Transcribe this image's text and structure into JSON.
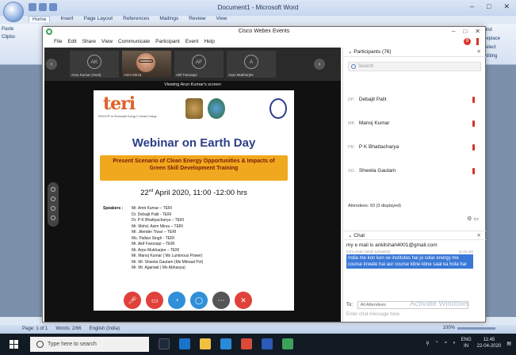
{
  "word": {
    "title": "Document1 - Microsoft Word",
    "tabs": [
      "Home",
      "Insert",
      "Page Layout",
      "References",
      "Mailings",
      "Review",
      "View"
    ],
    "ribbon_left": [
      "Paste",
      "Clipbo"
    ],
    "ribbon_right": [
      "Find",
      "Replace",
      "Select",
      "Editing"
    ],
    "status": {
      "page": "Page: 1 of 1",
      "words": "Words: 2/66",
      "lang": "English (India)",
      "zoom": "100%"
    }
  },
  "webex": {
    "title": "Cisco Webex Events",
    "menu": [
      "File",
      "Edit",
      "Share",
      "View",
      "Communicate",
      "Participant",
      "Event",
      "Help"
    ],
    "help_badge": "8",
    "thumbs": [
      {
        "initials": "AK",
        "name": "Arun Kumar (Host)"
      },
      {
        "initials": "",
        "name": "Asim Mirza"
      },
      {
        "initials": "AF",
        "name": "Akif Farooqui"
      },
      {
        "initials": "A",
        "name": "Arpo Mukherjee"
      }
    ],
    "viewing": "Viewing Arun Kumar's screen",
    "slide": {
      "logo": "teri",
      "logo_sub": "ENVIS RP on Renewable Energy & Climate Change",
      "title": "Webinar on Earth Day",
      "band_line1": "Present Scenario of Clean Energy Opportunities & Impacts of",
      "band_line2": "Green Skill Development Training",
      "date_day": "22",
      "date_sup": "nd",
      "date_rest": " April 2020, 11:00 -12:00 hrs",
      "speakers_label": "Speakers :",
      "speakers": [
        "Mr. Amit Kumar – TERI",
        "Dr. Debajit Palit - TERI",
        "Dr. P K Bhattyacharya – TERI",
        "Mr. Mohd. Asim Mirza – TERI",
        "Mr. Jitender Tiwar – TERI",
        "Ms. Pallavi Singh  - TERI",
        "Mr. Akif Farooqui – TERI",
        "Mr. Arpo Mukharjee – TERI",
        "Mr. Manoj Kumar ( Ms Luminous Power)",
        "Mr. Mr. Shweta Gautam (Ms Mimaat Pvt)",
        "Mr. Mr. Agarwal ( Ms Abhasya)"
      ]
    },
    "participants": {
      "header": "Participants (76)",
      "search_placeholder": "Search",
      "rows": [
        {
          "ini": "DP",
          "name": "Debajit Palit"
        },
        {
          "ini": "MK",
          "name": "Manoj Kumar"
        },
        {
          "ini": "PB",
          "name": "P K Bhattacharya"
        },
        {
          "ini": "SG",
          "name": "Shweta Gautam"
        }
      ],
      "attendees": "Attendees: 93 (3 displayed)"
    },
    "chat": {
      "header": "Chat",
      "msg1": "my e mail is ankitshah4001@gmail.com",
      "from": "from Aman Singh (privately)",
      "time": "11:41 AM",
      "selected": "India me kon kon se institutes hai jo solar energy me course krwate hai aur course kitne kitne saal ka hota hai",
      "to_label": "To:",
      "to_value": "All Attendees",
      "input_placeholder": "Enter chat message here"
    },
    "activate": "Activate Windows"
  },
  "taskbar": {
    "search_placeholder": "Type here to search",
    "lang": "ENG",
    "lang2": "IN",
    "time": "11:45",
    "date": "22-04-2020"
  },
  "colors": {
    "teri": "#e0602a",
    "band": "#f0a91e",
    "title_blue": "#2c3e87",
    "end_red": "#e0413a",
    "ctl_blue": "#2f8fd8"
  }
}
